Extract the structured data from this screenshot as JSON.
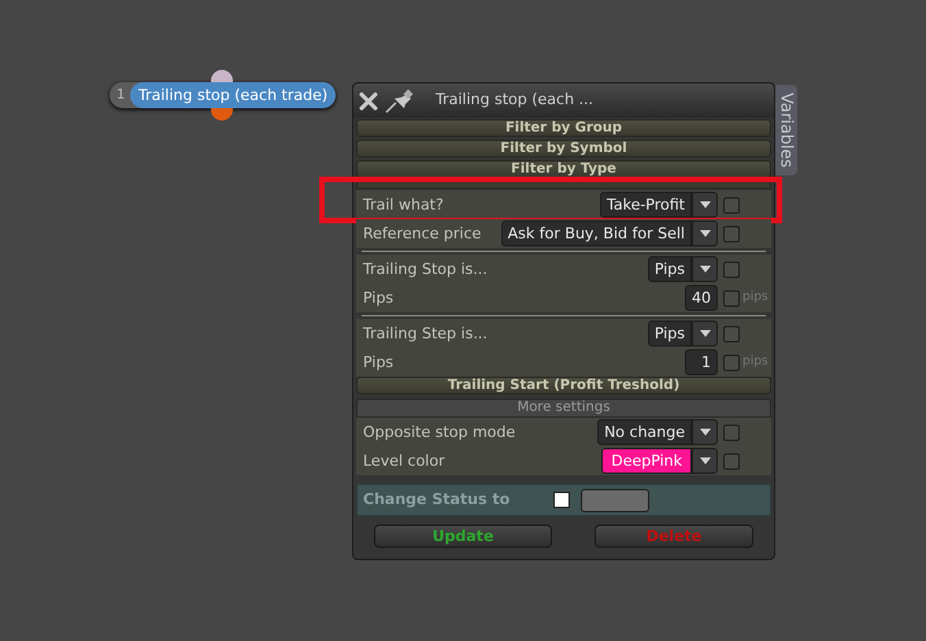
{
  "node": {
    "number": "1",
    "label": "Trailing stop (each trade)"
  },
  "window": {
    "title": "Trailing stop (each ...",
    "side_tab": "Variables"
  },
  "items": [
    {
      "kind": "header",
      "label": "Filter by Group"
    },
    {
      "kind": "header",
      "label": "Filter by Symbol"
    },
    {
      "kind": "header",
      "label": "Filter by Type"
    },
    {
      "kind": "select",
      "label": "Trail what?",
      "value": "Take-Profit",
      "checked": false,
      "highlighted": true
    },
    {
      "kind": "select",
      "label": "Reference price",
      "value": "Ask for Buy, Bid for Sell",
      "checked": false,
      "highlighted": false
    },
    {
      "kind": "divider"
    },
    {
      "kind": "select",
      "label": "Trailing Stop is...",
      "value": "Pips",
      "checked": false,
      "highlighted": false
    },
    {
      "kind": "number",
      "label": "Pips",
      "value": "40",
      "unit": "pips",
      "checked": false
    },
    {
      "kind": "divider"
    },
    {
      "kind": "select",
      "label": "Trailing Step is...",
      "value": "Pips",
      "checked": false,
      "highlighted": false
    },
    {
      "kind": "number",
      "label": "Pips",
      "value": "1",
      "unit": "pips",
      "checked": false
    },
    {
      "kind": "header",
      "label": "Trailing Start (Profit Treshold)"
    },
    {
      "kind": "subheader",
      "label": "More settings"
    },
    {
      "kind": "select",
      "label": "Opposite stop mode",
      "value": "No change",
      "checked": false,
      "highlighted": false
    },
    {
      "kind": "color",
      "label": "Level color",
      "value": "DeepPink",
      "color": "#ff1493",
      "checked": false
    }
  ],
  "status": {
    "label": "Change Status to",
    "checked": false
  },
  "buttons": [
    {
      "label": "Update",
      "kind": "update"
    },
    {
      "label": "Delete",
      "kind": "delete"
    }
  ]
}
